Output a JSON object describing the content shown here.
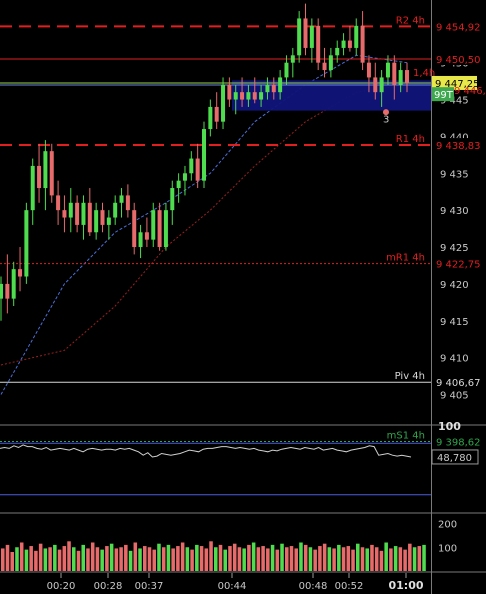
{
  "colors": {
    "background": "#000000",
    "up": "#4fdc4f",
    "down": "#e86b6b",
    "pivot_red": "#e21f1f",
    "pivot_green": "#2fa64a",
    "pivot_white": "#d8d8d8",
    "indicator_line": "#d0d0d0",
    "band_line": "#4a5de0",
    "current_price_bg": "#e8e84a",
    "order_bg": "#10147a"
  },
  "chart_data": [
    {
      "type": "candlestick",
      "title": "",
      "price_axis": {
        "ylim": [
          9401,
          9458.5
        ],
        "ticks": [
          9405,
          9410,
          9415,
          9420,
          9425,
          9430,
          9435,
          9440,
          9445,
          9450,
          9455
        ]
      },
      "time_axis": {
        "ticks": [
          "00:20",
          "00:28",
          "00:37",
          "00:44",
          "00:48",
          "00:52",
          "01:00"
        ],
        "bold_tick": "01:00"
      },
      "price_tags": {
        "current": "9 447,25",
        "order_price": "9 446,00",
        "order_label": "99T",
        "order_count": "3",
        "r1_side": "1,4h"
      },
      "levels": [
        {
          "name": "R2 4h",
          "value": "9 454,92",
          "price": 9454.92,
          "color": "red",
          "style": "dash"
        },
        {
          "name": "",
          "value": "9 450,50",
          "price": 9450.5,
          "color": "red",
          "style": "solid"
        },
        {
          "name": "R1 4h",
          "value": "9 438,83",
          "price": 9438.83,
          "color": "red",
          "style": "dash"
        },
        {
          "name": "mR1 4h",
          "value": "9 422,75",
          "price": 9422.75,
          "color": "red",
          "style": "dot"
        },
        {
          "name": "Piv 4h",
          "value": "9 406,67",
          "price": 9406.67,
          "color": "white",
          "style": "solid"
        },
        {
          "name": "mS1 4h",
          "value": "9 398,62",
          "price": 9398.62,
          "color": "green",
          "style": "dot"
        }
      ],
      "candles": [
        {
          "o": 9418,
          "h": 9421,
          "l": 9415,
          "c": 9420
        },
        {
          "o": 9420,
          "h": 9424,
          "l": 9416,
          "c": 9418
        },
        {
          "o": 9418,
          "h": 9423,
          "l": 9417,
          "c": 9422
        },
        {
          "o": 9422,
          "h": 9425,
          "l": 9419,
          "c": 9421
        },
        {
          "o": 9421,
          "h": 9431,
          "l": 9420,
          "c": 9430
        },
        {
          "o": 9430,
          "h": 9437,
          "l": 9428,
          "c": 9436
        },
        {
          "o": 9436,
          "h": 9439,
          "l": 9431,
          "c": 9433
        },
        {
          "o": 9433,
          "h": 9439.5,
          "l": 9430,
          "c": 9438
        },
        {
          "o": 9438,
          "h": 9439,
          "l": 9431,
          "c": 9432
        },
        {
          "o": 9432,
          "h": 9434,
          "l": 9428,
          "c": 9430
        },
        {
          "o": 9430,
          "h": 9432,
          "l": 9427,
          "c": 9429
        },
        {
          "o": 9429,
          "h": 9433,
          "l": 9427,
          "c": 9431
        },
        {
          "o": 9431,
          "h": 9432,
          "l": 9427,
          "c": 9428
        },
        {
          "o": 9428,
          "h": 9432,
          "l": 9426,
          "c": 9431
        },
        {
          "o": 9431,
          "h": 9433,
          "l": 9426.5,
          "c": 9427
        },
        {
          "o": 9427,
          "h": 9431,
          "l": 9426,
          "c": 9430
        },
        {
          "o": 9430,
          "h": 9431,
          "l": 9427,
          "c": 9428
        },
        {
          "o": 9428,
          "h": 9430,
          "l": 9426,
          "c": 9429
        },
        {
          "o": 9429,
          "h": 9432,
          "l": 9428,
          "c": 9431
        },
        {
          "o": 9431,
          "h": 9433,
          "l": 9429,
          "c": 9432
        },
        {
          "o": 9432,
          "h": 9433.5,
          "l": 9429,
          "c": 9430
        },
        {
          "o": 9430,
          "h": 9431,
          "l": 9424,
          "c": 9425
        },
        {
          "o": 9425,
          "h": 9428,
          "l": 9423.5,
          "c": 9427
        },
        {
          "o": 9427,
          "h": 9429,
          "l": 9425,
          "c": 9426
        },
        {
          "o": 9426,
          "h": 9431,
          "l": 9425,
          "c": 9430
        },
        {
          "o": 9430,
          "h": 9431,
          "l": 9424.5,
          "c": 9425
        },
        {
          "o": 9425,
          "h": 9431,
          "l": 9424.5,
          "c": 9430
        },
        {
          "o": 9430,
          "h": 9434,
          "l": 9428,
          "c": 9433
        },
        {
          "o": 9433,
          "h": 9435,
          "l": 9431,
          "c": 9434
        },
        {
          "o": 9434,
          "h": 9436,
          "l": 9432,
          "c": 9435
        },
        {
          "o": 9435,
          "h": 9438,
          "l": 9434,
          "c": 9437
        },
        {
          "o": 9437,
          "h": 9439,
          "l": 9433,
          "c": 9434
        },
        {
          "o": 9434,
          "h": 9442,
          "l": 9433,
          "c": 9441
        },
        {
          "o": 9441,
          "h": 9445,
          "l": 9440,
          "c": 9444
        },
        {
          "o": 9444,
          "h": 9446,
          "l": 9441,
          "c": 9442
        },
        {
          "o": 9442,
          "h": 9448,
          "l": 9441,
          "c": 9447
        },
        {
          "o": 9447,
          "h": 9448,
          "l": 9444,
          "c": 9445
        },
        {
          "o": 9445,
          "h": 9447,
          "l": 9443,
          "c": 9446
        },
        {
          "o": 9446,
          "h": 9448,
          "l": 9444,
          "c": 9445
        },
        {
          "o": 9445,
          "h": 9447,
          "l": 9444,
          "c": 9446
        },
        {
          "o": 9446,
          "h": 9448,
          "l": 9444.5,
          "c": 9445
        },
        {
          "o": 9445,
          "h": 9447,
          "l": 9444,
          "c": 9446
        },
        {
          "o": 9446,
          "h": 9448,
          "l": 9445,
          "c": 9447
        },
        {
          "o": 9447,
          "h": 9448,
          "l": 9445,
          "c": 9446
        },
        {
          "o": 9446,
          "h": 9449,
          "l": 9445,
          "c": 9448
        },
        {
          "o": 9448,
          "h": 9451,
          "l": 9447,
          "c": 9450
        },
        {
          "o": 9450,
          "h": 9452,
          "l": 9448,
          "c": 9451
        },
        {
          "o": 9451,
          "h": 9457,
          "l": 9450,
          "c": 9456
        },
        {
          "o": 9456,
          "h": 9458,
          "l": 9451,
          "c": 9452
        },
        {
          "o": 9452,
          "h": 9456,
          "l": 9450,
          "c": 9455
        },
        {
          "o": 9455,
          "h": 9456,
          "l": 9449,
          "c": 9450
        },
        {
          "o": 9450,
          "h": 9452,
          "l": 9448,
          "c": 9449
        },
        {
          "o": 9449,
          "h": 9452,
          "l": 9448,
          "c": 9451
        },
        {
          "o": 9451,
          "h": 9453,
          "l": 9450,
          "c": 9452
        },
        {
          "o": 9452,
          "h": 9454,
          "l": 9451,
          "c": 9453
        },
        {
          "o": 9453,
          "h": 9455,
          "l": 9451.5,
          "c": 9452
        },
        {
          "o": 9452,
          "h": 9456,
          "l": 9451,
          "c": 9455
        },
        {
          "o": 9455,
          "h": 9457,
          "l": 9449,
          "c": 9450
        },
        {
          "o": 9450,
          "h": 9451,
          "l": 9446,
          "c": 9448
        },
        {
          "o": 9448,
          "h": 9450,
          "l": 9445,
          "c": 9446
        },
        {
          "o": 9446,
          "h": 9449,
          "l": 9444,
          "c": 9448
        },
        {
          "o": 9448,
          "h": 9451,
          "l": 9447,
          "c": 9450
        },
        {
          "o": 9450,
          "h": 9451,
          "l": 9445,
          "c": 9447
        },
        {
          "o": 9447,
          "h": 9450,
          "l": 9446,
          "c": 9449
        },
        {
          "o": 9449,
          "h": 9450,
          "l": 9446,
          "c": 9447.25
        }
      ],
      "moving_averages": [
        {
          "color": "#4a6fd8",
          "style": "dash",
          "points": [
            [
              0,
              9405
            ],
            [
              10,
              9420
            ],
            [
              18,
              9427
            ],
            [
              26,
              9431
            ],
            [
              33,
              9435
            ],
            [
              40,
              9442
            ],
            [
              48,
              9447
            ],
            [
              56,
              9451
            ],
            [
              64,
              9450
            ]
          ]
        },
        {
          "color": "#9a2020",
          "style": "dot",
          "points": [
            [
              0,
              9409
            ],
            [
              10,
              9411
            ],
            [
              18,
              9417
            ],
            [
              26,
              9425
            ],
            [
              33,
              9430
            ],
            [
              40,
              9436
            ],
            [
              48,
              9442
            ],
            [
              56,
              9446
            ],
            [
              64,
              9447
            ]
          ]
        }
      ]
    },
    {
      "type": "line",
      "title": "",
      "ylim": [
        0,
        100
      ],
      "ticks": [
        100
      ],
      "bands": [
        80,
        20
      ],
      "last_value": "48,780",
      "values": [
        74,
        75,
        74,
        77,
        75,
        78,
        76,
        76,
        74,
        73,
        75,
        72,
        73,
        74,
        73,
        72,
        74,
        72,
        70,
        73,
        74,
        73,
        72,
        73,
        73,
        72,
        74,
        73,
        74,
        72,
        70,
        66,
        69,
        64,
        65,
        68,
        67,
        66,
        67,
        68,
        70,
        72,
        71,
        70,
        73,
        74,
        74,
        75,
        76,
        76,
        75,
        74,
        75,
        74,
        73,
        74,
        72,
        71,
        70,
        72,
        71,
        73,
        74,
        75,
        74,
        73,
        75,
        74,
        73,
        75,
        72,
        73,
        74,
        72,
        71,
        70,
        72,
        73,
        74,
        75,
        77,
        76,
        66,
        67,
        68,
        66,
        65,
        66,
        65,
        64
      ]
    },
    {
      "type": "bar",
      "title": "",
      "ylim": [
        0,
        240
      ],
      "ticks": [
        100,
        200
      ],
      "values": [
        95,
        110,
        80,
        100,
        120,
        90,
        105,
        85,
        115,
        95,
        100,
        110,
        90,
        105,
        125,
        100,
        85,
        110,
        95,
        120,
        100,
        90,
        105,
        115,
        95,
        100,
        110,
        85,
        120,
        95,
        105,
        100,
        90,
        115,
        100,
        110,
        95,
        105,
        120,
        100,
        90,
        110,
        105,
        95,
        125,
        100,
        110,
        90,
        105,
        115,
        100,
        95,
        110,
        120,
        100,
        105,
        95,
        110,
        90,
        115,
        100,
        105,
        95,
        120,
        110,
        100,
        90,
        105,
        115,
        100,
        95,
        110,
        100,
        105,
        90,
        115,
        100,
        95,
        110,
        100,
        85,
        120,
        95,
        105,
        100,
        90,
        115,
        100,
        105,
        110
      ]
    }
  ]
}
